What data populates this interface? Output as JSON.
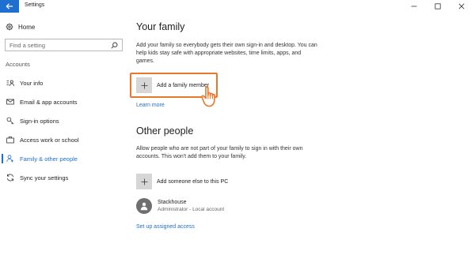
{
  "window": {
    "title": "Settings",
    "accent": "#1f6fd0"
  },
  "sidebar": {
    "home_label": "Home",
    "search_placeholder": "Find a setting",
    "section_label": "Accounts",
    "items": [
      {
        "label": "Your info",
        "icon": "your-info-icon"
      },
      {
        "label": "Email & app accounts",
        "icon": "mail-icon"
      },
      {
        "label": "Sign-in options",
        "icon": "key-icon"
      },
      {
        "label": "Access work or school",
        "icon": "briefcase-icon"
      },
      {
        "label": "Family & other people",
        "icon": "person-icon",
        "active": true
      },
      {
        "label": "Sync your settings",
        "icon": "sync-icon"
      }
    ]
  },
  "main": {
    "family": {
      "heading": "Your family",
      "description": "Add your family so everybody gets their own sign-in and desktop. You can help kids stay safe with appropriate websites, time limits, apps, and games.",
      "add_label": "Add a family member",
      "learn_more": "Learn more"
    },
    "other": {
      "heading": "Other people",
      "description": "Allow people who are not part of your family to sign in with their own accounts. This won't add them to your family.",
      "add_label": "Add someone else to this PC",
      "user_name": "Stackhouse",
      "user_detail": "Administrator - Local account",
      "assigned_access": "Set up assigned access"
    }
  },
  "highlight_color": "#e8782c"
}
